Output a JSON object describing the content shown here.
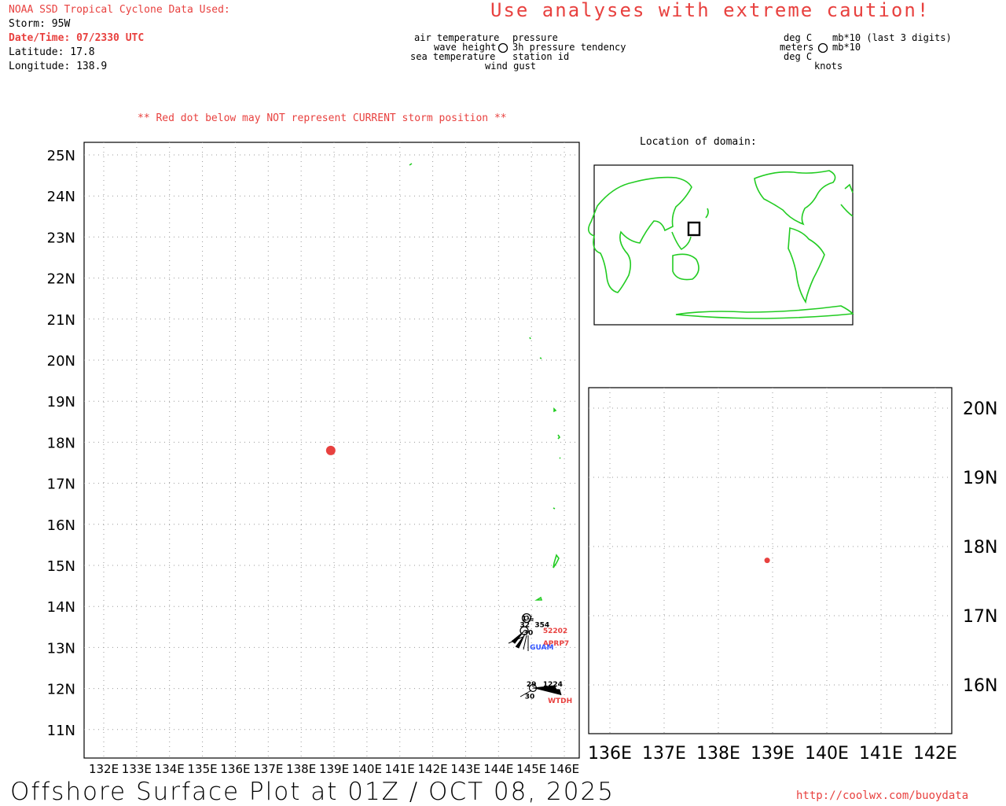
{
  "header": {
    "source_line": "NOAA SSD Tropical Cyclone Data Used:",
    "storm": "Storm: 95W",
    "datetime": "Date/Time: 07/2330 UTC",
    "latitude": "Latitude: 17.8",
    "longitude": "Longitude: 138.9",
    "caution": "Use analyses with extreme caution!",
    "red_dot_note": "** Red dot below may NOT represent CURRENT storm position **"
  },
  "legend_left": {
    "air_temperature": "air temperature",
    "wave_height": "wave height",
    "sea_temperature": "sea temperature",
    "wind_gust": "wind gust",
    "pressure": "pressure",
    "pressure_tendency": "3h pressure tendency",
    "station_id": "station id"
  },
  "legend_right": {
    "deg_c_1": "deg C",
    "meters": "meters",
    "deg_c_2": "deg C",
    "knots": "knots",
    "mb_last3": "mb*10 (last 3 digits)",
    "mb10": "mb*10"
  },
  "inset_title": "Location of domain:",
  "footer": {
    "title": "Offshore Surface Plot at 01Z / OCT 08, 2025",
    "url": "http://coolwx.com/buoydata"
  },
  "colors": {
    "coastline": "#22cc22",
    "storm_dot": "#e8413f",
    "header_red": "#e8413f",
    "station_id_blue": "#3355ff"
  },
  "main_map": {
    "lon_labels": [
      "132E",
      "133E",
      "134E",
      "135E",
      "136E",
      "137E",
      "138E",
      "139E",
      "140E",
      "141E",
      "142E",
      "143E",
      "144E",
      "145E",
      "146E"
    ],
    "lat_labels": [
      "25N",
      "24N",
      "23N",
      "22N",
      "21N",
      "20N",
      "19N",
      "18N",
      "17N",
      "16N",
      "15N",
      "14N",
      "13N",
      "12N",
      "11N"
    ],
    "storm_position": {
      "lat": 17.8,
      "lon": 138.9
    },
    "station_labels": [
      {
        "text": "1½",
        "lat": 13.65,
        "lon": 144.7,
        "color": "#000"
      },
      {
        "text": "32",
        "lat": 13.5,
        "lon": 144.65,
        "color": "#000"
      },
      {
        "text": "354",
        "lat": 13.5,
        "lon": 145.1,
        "color": "#000"
      },
      {
        "text": "30",
        "lat": 13.3,
        "lon": 144.75,
        "color": "#000"
      },
      {
        "text": "52202",
        "lat": 13.35,
        "lon": 145.35,
        "color": "#e8413f"
      },
      {
        "text": "APRP7",
        "lat": 13.05,
        "lon": 145.35,
        "color": "#e8413f"
      },
      {
        "text": "GUAM",
        "lat": 12.95,
        "lon": 144.95,
        "color": "#3355ff"
      },
      {
        "text": "29",
        "lat": 12.05,
        "lon": 144.85,
        "color": "#000"
      },
      {
        "text": "1224",
        "lat": 12.05,
        "lon": 145.35,
        "color": "#000"
      },
      {
        "text": "30",
        "lat": 11.75,
        "lon": 144.8,
        "color": "#000"
      },
      {
        "text": "WTDH",
        "lat": 11.65,
        "lon": 145.5,
        "color": "#e8413f"
      }
    ]
  },
  "zoom_map": {
    "lon_labels": [
      "136E",
      "137E",
      "138E",
      "139E",
      "140E",
      "141E",
      "142E"
    ],
    "lat_labels": [
      "20N",
      "19N",
      "18N",
      "17N",
      "16N"
    ],
    "storm_position": {
      "lat": 17.8,
      "lon": 138.9
    }
  }
}
